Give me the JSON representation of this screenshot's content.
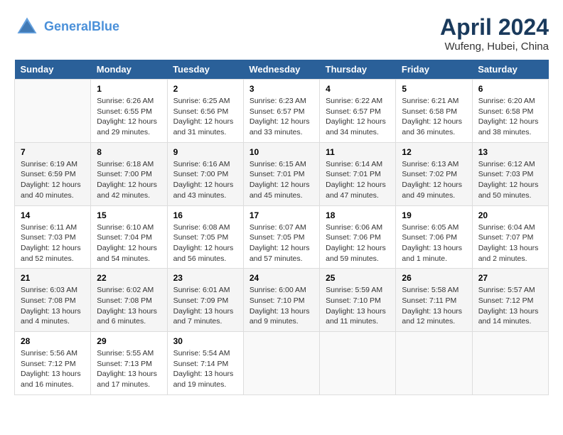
{
  "header": {
    "logo_line1": "General",
    "logo_line2": "Blue",
    "title": "April 2024",
    "subtitle": "Wufeng, Hubei, China"
  },
  "calendar": {
    "days_of_week": [
      "Sunday",
      "Monday",
      "Tuesday",
      "Wednesday",
      "Thursday",
      "Friday",
      "Saturday"
    ],
    "weeks": [
      [
        {
          "day": "",
          "info": ""
        },
        {
          "day": "1",
          "info": "Sunrise: 6:26 AM\nSunset: 6:55 PM\nDaylight: 12 hours\nand 29 minutes."
        },
        {
          "day": "2",
          "info": "Sunrise: 6:25 AM\nSunset: 6:56 PM\nDaylight: 12 hours\nand 31 minutes."
        },
        {
          "day": "3",
          "info": "Sunrise: 6:23 AM\nSunset: 6:57 PM\nDaylight: 12 hours\nand 33 minutes."
        },
        {
          "day": "4",
          "info": "Sunrise: 6:22 AM\nSunset: 6:57 PM\nDaylight: 12 hours\nand 34 minutes."
        },
        {
          "day": "5",
          "info": "Sunrise: 6:21 AM\nSunset: 6:58 PM\nDaylight: 12 hours\nand 36 minutes."
        },
        {
          "day": "6",
          "info": "Sunrise: 6:20 AM\nSunset: 6:58 PM\nDaylight: 12 hours\nand 38 minutes."
        }
      ],
      [
        {
          "day": "7",
          "info": "Sunrise: 6:19 AM\nSunset: 6:59 PM\nDaylight: 12 hours\nand 40 minutes."
        },
        {
          "day": "8",
          "info": "Sunrise: 6:18 AM\nSunset: 7:00 PM\nDaylight: 12 hours\nand 42 minutes."
        },
        {
          "day": "9",
          "info": "Sunrise: 6:16 AM\nSunset: 7:00 PM\nDaylight: 12 hours\nand 43 minutes."
        },
        {
          "day": "10",
          "info": "Sunrise: 6:15 AM\nSunset: 7:01 PM\nDaylight: 12 hours\nand 45 minutes."
        },
        {
          "day": "11",
          "info": "Sunrise: 6:14 AM\nSunset: 7:01 PM\nDaylight: 12 hours\nand 47 minutes."
        },
        {
          "day": "12",
          "info": "Sunrise: 6:13 AM\nSunset: 7:02 PM\nDaylight: 12 hours\nand 49 minutes."
        },
        {
          "day": "13",
          "info": "Sunrise: 6:12 AM\nSunset: 7:03 PM\nDaylight: 12 hours\nand 50 minutes."
        }
      ],
      [
        {
          "day": "14",
          "info": "Sunrise: 6:11 AM\nSunset: 7:03 PM\nDaylight: 12 hours\nand 52 minutes."
        },
        {
          "day": "15",
          "info": "Sunrise: 6:10 AM\nSunset: 7:04 PM\nDaylight: 12 hours\nand 54 minutes."
        },
        {
          "day": "16",
          "info": "Sunrise: 6:08 AM\nSunset: 7:05 PM\nDaylight: 12 hours\nand 56 minutes."
        },
        {
          "day": "17",
          "info": "Sunrise: 6:07 AM\nSunset: 7:05 PM\nDaylight: 12 hours\nand 57 minutes."
        },
        {
          "day": "18",
          "info": "Sunrise: 6:06 AM\nSunset: 7:06 PM\nDaylight: 12 hours\nand 59 minutes."
        },
        {
          "day": "19",
          "info": "Sunrise: 6:05 AM\nSunset: 7:06 PM\nDaylight: 13 hours\nand 1 minute."
        },
        {
          "day": "20",
          "info": "Sunrise: 6:04 AM\nSunset: 7:07 PM\nDaylight: 13 hours\nand 2 minutes."
        }
      ],
      [
        {
          "day": "21",
          "info": "Sunrise: 6:03 AM\nSunset: 7:08 PM\nDaylight: 13 hours\nand 4 minutes."
        },
        {
          "day": "22",
          "info": "Sunrise: 6:02 AM\nSunset: 7:08 PM\nDaylight: 13 hours\nand 6 minutes."
        },
        {
          "day": "23",
          "info": "Sunrise: 6:01 AM\nSunset: 7:09 PM\nDaylight: 13 hours\nand 7 minutes."
        },
        {
          "day": "24",
          "info": "Sunrise: 6:00 AM\nSunset: 7:10 PM\nDaylight: 13 hours\nand 9 minutes."
        },
        {
          "day": "25",
          "info": "Sunrise: 5:59 AM\nSunset: 7:10 PM\nDaylight: 13 hours\nand 11 minutes."
        },
        {
          "day": "26",
          "info": "Sunrise: 5:58 AM\nSunset: 7:11 PM\nDaylight: 13 hours\nand 12 minutes."
        },
        {
          "day": "27",
          "info": "Sunrise: 5:57 AM\nSunset: 7:12 PM\nDaylight: 13 hours\nand 14 minutes."
        }
      ],
      [
        {
          "day": "28",
          "info": "Sunrise: 5:56 AM\nSunset: 7:12 PM\nDaylight: 13 hours\nand 16 minutes."
        },
        {
          "day": "29",
          "info": "Sunrise: 5:55 AM\nSunset: 7:13 PM\nDaylight: 13 hours\nand 17 minutes."
        },
        {
          "day": "30",
          "info": "Sunrise: 5:54 AM\nSunset: 7:14 PM\nDaylight: 13 hours\nand 19 minutes."
        },
        {
          "day": "",
          "info": ""
        },
        {
          "day": "",
          "info": ""
        },
        {
          "day": "",
          "info": ""
        },
        {
          "day": "",
          "info": ""
        }
      ]
    ]
  }
}
